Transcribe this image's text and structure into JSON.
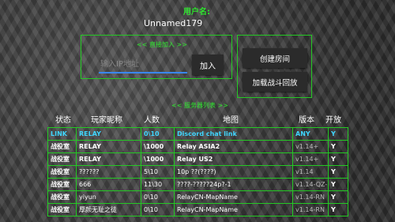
{
  "header": {
    "player_label": "用户名:",
    "player_name": "Unnamed179"
  },
  "direct_join": {
    "title": "<< 直接加入 >>",
    "placeholder": "输入IP地址",
    "join_label": "加入"
  },
  "room": {
    "create_label": "创建房间",
    "load_replay_label": "加载战斗回放"
  },
  "server_list": {
    "title": "<< 服务器列表 >>",
    "columns": [
      "状态",
      "玩家昵称",
      "人数",
      "地图",
      "版本",
      "开放"
    ],
    "rows": [
      {
        "status": "LINK",
        "name": "RELAY",
        "players": "0\\10",
        "map": "Discord chat link",
        "version": "ANY",
        "open": "Y",
        "is_link": true
      },
      {
        "status": "战役室",
        "name": "RELAY",
        "players": "\\1000",
        "map": "Relay ASIA2",
        "version": "v1.14+",
        "open": "Y",
        "bold": true
      },
      {
        "status": "战役室",
        "name": "RELAY",
        "players": "\\1000",
        "map": "Relay US2",
        "version": "v1.14+",
        "open": "Y",
        "bold": true
      },
      {
        "status": "战役室",
        "name": "??????",
        "players": "5\\10",
        "map": "10p ??(????)",
        "version": "v1.14",
        "open": "Y"
      },
      {
        "status": "战役室",
        "name": "666",
        "players": "11\\30",
        "map": "????-?????24p?-1",
        "version": "v1.14-QZ-",
        "open": "Y"
      },
      {
        "status": "战役室",
        "name": "yiyun",
        "players": "0\\10",
        "map": "RelayCN-MapName",
        "version": "v1.14-RN",
        "open": "Y"
      },
      {
        "status": "战役室",
        "name": "厚颜无耻之徒",
        "players": "0\\10",
        "map": "RelayCN-MapName",
        "version": "v1.14-RN",
        "open": "Y"
      }
    ]
  },
  "colors": {
    "accent_green": "#2ee62e",
    "border_green": "#24c924",
    "link_cyan": "#3fd6ff",
    "input_underline": "#3a87ff"
  }
}
